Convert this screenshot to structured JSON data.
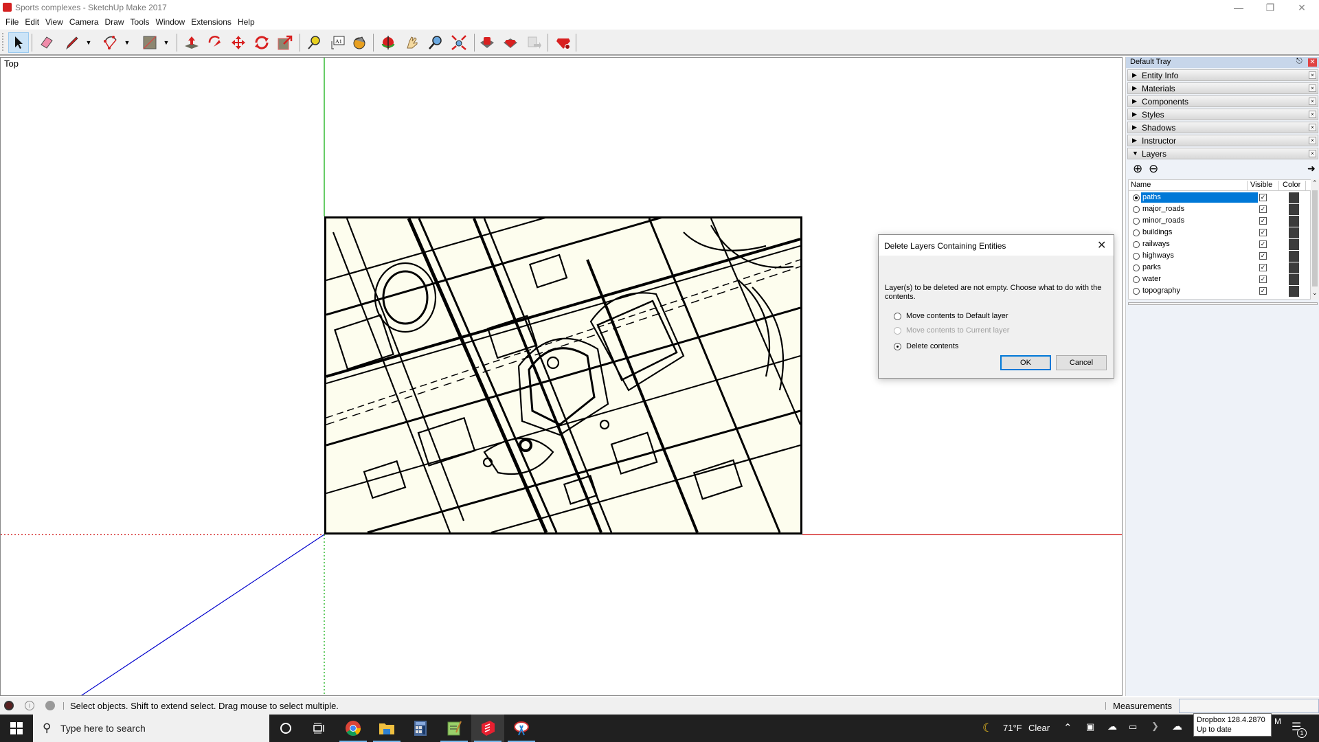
{
  "window": {
    "title": "Sports complexes - SketchUp Make 2017",
    "controls": [
      "minimize",
      "restore",
      "close"
    ]
  },
  "menu": [
    "File",
    "Edit",
    "View",
    "Camera",
    "Draw",
    "Tools",
    "Window",
    "Extensions",
    "Help"
  ],
  "toolbar": {
    "tools": [
      {
        "name": "select-tool",
        "icon": "arrow-cursor-icon",
        "active": true
      },
      {
        "name": "eraser-tool",
        "icon": "eraser-icon"
      },
      {
        "name": "line-tool",
        "icon": "pencil-icon",
        "dropdown": true
      },
      {
        "name": "arc-tool",
        "icon": "arc-icon",
        "dropdown": true
      },
      {
        "name": "rectangle-tool",
        "icon": "rectangle-icon",
        "dropdown": true
      },
      {
        "name": "push-pull-tool",
        "icon": "push-pull-icon"
      },
      {
        "name": "offset-tool",
        "icon": "offset-icon"
      },
      {
        "name": "move-tool",
        "icon": "move-icon"
      },
      {
        "name": "rotate-tool",
        "icon": "rotate-icon"
      },
      {
        "name": "scale-tool",
        "icon": "scale-icon"
      },
      {
        "name": "tape-measure-tool",
        "icon": "tape-measure-icon"
      },
      {
        "name": "text-tool",
        "icon": "text-icon"
      },
      {
        "name": "paint-bucket-tool",
        "icon": "paint-bucket-icon"
      },
      {
        "name": "orbit-tool",
        "icon": "orbit-icon"
      },
      {
        "name": "pan-tool",
        "icon": "hand-icon"
      },
      {
        "name": "zoom-tool",
        "icon": "magnifier-icon"
      },
      {
        "name": "zoom-extents-tool",
        "icon": "zoom-extents-icon"
      },
      {
        "name": "3d-warehouse",
        "icon": "warehouse-icon"
      },
      {
        "name": "extension-warehouse",
        "icon": "ruby-box-icon"
      },
      {
        "name": "send-to-layout",
        "icon": "layout-icon",
        "disabled": true
      },
      {
        "name": "extension-manager",
        "icon": "ruby-gear-icon"
      }
    ]
  },
  "viewport": {
    "view_label": "Top"
  },
  "tray": {
    "title": "Default Tray",
    "panels": [
      {
        "label": "Entity Info",
        "expanded": false
      },
      {
        "label": "Materials",
        "expanded": false
      },
      {
        "label": "Components",
        "expanded": false
      },
      {
        "label": "Styles",
        "expanded": false
      },
      {
        "label": "Shadows",
        "expanded": false
      },
      {
        "label": "Instructor",
        "expanded": false
      },
      {
        "label": "Layers",
        "expanded": true
      }
    ],
    "layers": {
      "columns": {
        "name": "Name",
        "visible": "Visible",
        "color": "Color"
      },
      "rows": [
        {
          "name": "paths",
          "active": true,
          "selected": true,
          "visible": true,
          "color": "#3c3c3c"
        },
        {
          "name": "major_roads",
          "active": false,
          "selected": false,
          "visible": true,
          "color": "#3c3c3c"
        },
        {
          "name": "minor_roads",
          "active": false,
          "selected": false,
          "visible": true,
          "color": "#3c3c3c"
        },
        {
          "name": "buildings",
          "active": false,
          "selected": false,
          "visible": true,
          "color": "#3c3c3c"
        },
        {
          "name": "railways",
          "active": false,
          "selected": false,
          "visible": true,
          "color": "#3c3c3c"
        },
        {
          "name": "highways",
          "active": false,
          "selected": false,
          "visible": true,
          "color": "#3c3c3c"
        },
        {
          "name": "parks",
          "active": false,
          "selected": false,
          "visible": true,
          "color": "#3c3c3c"
        },
        {
          "name": "water",
          "active": false,
          "selected": false,
          "visible": true,
          "color": "#3c3c3c"
        },
        {
          "name": "topography",
          "active": false,
          "selected": false,
          "visible": true,
          "color": "#3c3c3c"
        }
      ]
    }
  },
  "dialog": {
    "title": "Delete Layers Containing Entities",
    "message": "Layer(s) to be deleted are not empty.  Choose what to do with the contents.",
    "options": [
      {
        "label": "Move contents to Default layer",
        "selected": false,
        "disabled": false
      },
      {
        "label": "Move contents to Current layer",
        "selected": false,
        "disabled": true
      },
      {
        "label": "Delete contents",
        "selected": true,
        "disabled": false
      }
    ],
    "ok_label": "OK",
    "cancel_label": "Cancel"
  },
  "statusbar": {
    "message": "Select objects. Shift to extend select. Drag mouse to select multiple.",
    "measurements_label": "Measurements",
    "measurements_value": ""
  },
  "taskbar": {
    "search_placeholder": "Type here to search",
    "apps": [
      "cortana",
      "task-view",
      "chrome",
      "file-explorer",
      "calculator",
      "notepad-plus",
      "sketchup",
      "snipping-tool"
    ],
    "weather": {
      "temp": "71°F",
      "condition": "Clear"
    },
    "tooltip": {
      "line1": "Dropbox 128.4.2870",
      "line2": "Up to date"
    },
    "clock_partial": "M",
    "notifications_count": "1"
  },
  "colors": {
    "axis_red": "#cc0000",
    "axis_green": "#00aa00",
    "axis_blue": "#0000cc",
    "map_background": "#fdfdee",
    "selection_blue": "#0078d7"
  }
}
